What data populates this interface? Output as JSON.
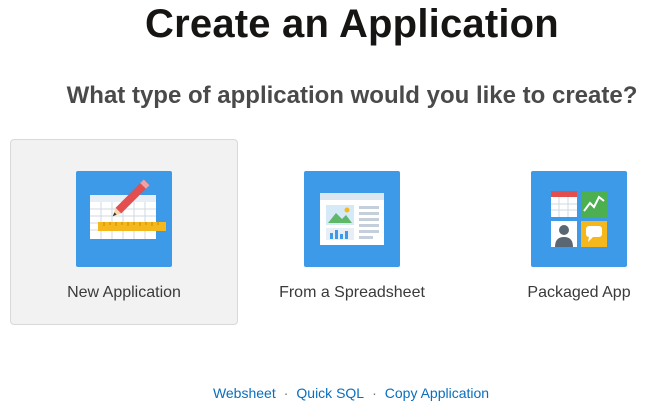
{
  "header": {
    "title": "Create an Application",
    "subtitle": "What type of application would you like to create?"
  },
  "tiles": [
    {
      "label": "New Application",
      "icon": "new-application-icon",
      "selected": true
    },
    {
      "label": "From a Spreadsheet",
      "icon": "spreadsheet-icon",
      "selected": false
    },
    {
      "label": "Packaged App",
      "icon": "packaged-app-icon",
      "selected": false
    }
  ],
  "footer_links": {
    "items": [
      "Websheet",
      "Quick SQL",
      "Copy Application"
    ],
    "separator": "·"
  },
  "colors": {
    "icon_background": "#3d9ae8",
    "link": "#0a6ebd",
    "selected_tile": "#f2f2f2"
  }
}
